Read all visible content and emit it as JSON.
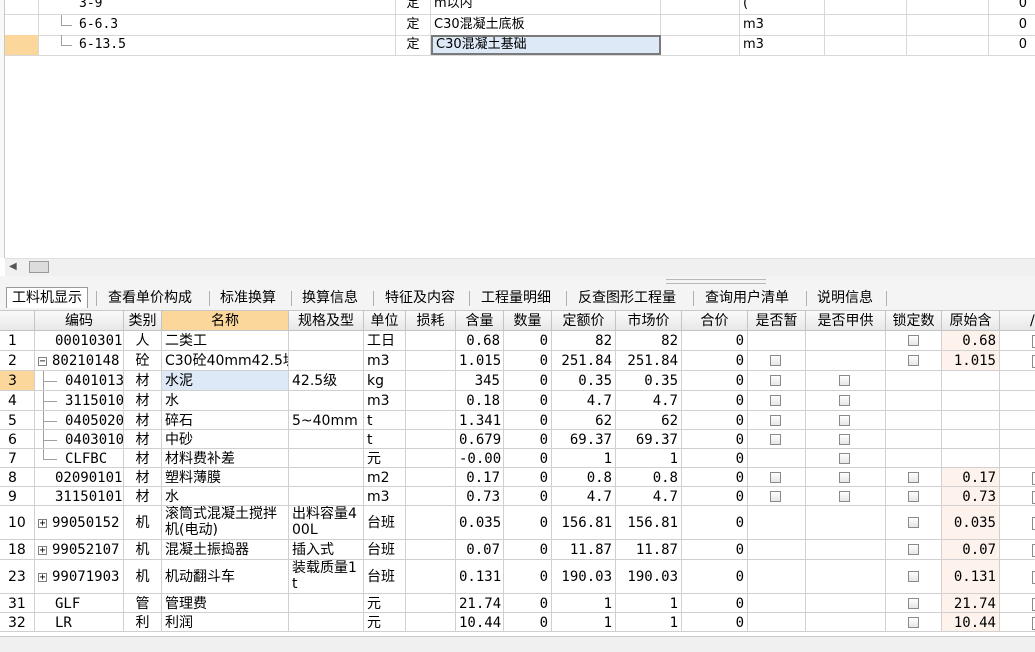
{
  "top_table": {
    "rows": [
      {
        "code": "3-9",
        "type": "定",
        "name": "m以内",
        "unit": "",
        "extra": "(",
        "last": "0"
      },
      {
        "code": "6-6.3",
        "type": "定",
        "name": "C30混凝土底板",
        "unit": "m3",
        "extra": "",
        "last": "0"
      },
      {
        "code": "6-13.5",
        "type": "定",
        "name": "C30混凝土基础",
        "unit": "m3",
        "extra": "",
        "last": "0"
      }
    ]
  },
  "tabs": [
    "工料机显示",
    "查看单价构成",
    "标准换算",
    "换算信息",
    "特征及内容",
    "工程量明细",
    "反查图形工程量",
    "查询用户清单",
    "说明信息"
  ],
  "grid": {
    "headers": [
      "编码",
      "类别",
      "名称",
      "规格及型",
      "单位",
      "损耗",
      "含量",
      "数量",
      "定额价",
      "市场价",
      "合价",
      "是否暂",
      "是否甲供",
      "锁定数",
      "原始含"
    ],
    "rows": [
      {
        "n": "1",
        "code": "00010301",
        "cat": "人",
        "name": "二类工",
        "spec": "",
        "unit": "工日",
        "loss": "",
        "qty": "0.68",
        "num": "0",
        "price": "82",
        "mkt": "82",
        "total": "0",
        "zan": false,
        "jia": false,
        "lock": true,
        "orig": "0.68"
      },
      {
        "n": "2",
        "code": "80210148",
        "cat": "砼",
        "name": "C30砼40mm42.5坍",
        "spec": "",
        "unit": "m3",
        "loss": "",
        "qty": "1.015",
        "num": "0",
        "price": "251.84",
        "mkt": "251.84",
        "total": "0",
        "zan": true,
        "jia": false,
        "lock": true,
        "orig": "1.015"
      },
      {
        "n": "3",
        "code": "0401013",
        "cat": "材",
        "name": "水泥",
        "spec": "42.5级",
        "unit": "kg",
        "loss": "",
        "qty": "345",
        "num": "0",
        "price": "0.35",
        "mkt": "0.35",
        "total": "0",
        "zan": true,
        "jia": true,
        "lock": false,
        "orig": ""
      },
      {
        "n": "4",
        "code": "3115010",
        "cat": "材",
        "name": "水",
        "spec": "",
        "unit": "m3",
        "loss": "",
        "qty": "0.18",
        "num": "0",
        "price": "4.7",
        "mkt": "4.7",
        "total": "0",
        "zan": true,
        "jia": true,
        "lock": false,
        "orig": ""
      },
      {
        "n": "5",
        "code": "0405020",
        "cat": "材",
        "name": "碎石",
        "spec": "5~40mm",
        "unit": "t",
        "loss": "",
        "qty": "1.341",
        "num": "0",
        "price": "62",
        "mkt": "62",
        "total": "0",
        "zan": true,
        "jia": true,
        "lock": false,
        "orig": ""
      },
      {
        "n": "6",
        "code": "0403010",
        "cat": "材",
        "name": "中砂",
        "spec": "",
        "unit": "t",
        "loss": "",
        "qty": "0.679",
        "num": "0",
        "price": "69.37",
        "mkt": "69.37",
        "total": "0",
        "zan": true,
        "jia": true,
        "lock": false,
        "orig": ""
      },
      {
        "n": "7",
        "code": "CLFBC",
        "cat": "材",
        "name": "材料费补差",
        "spec": "",
        "unit": "元",
        "loss": "",
        "qty": "-0.00",
        "num": "0",
        "price": "1",
        "mkt": "1",
        "total": "0",
        "zan": false,
        "jia": true,
        "lock": false,
        "orig": ""
      },
      {
        "n": "8",
        "code": "02090101",
        "cat": "材",
        "name": "塑料薄膜",
        "spec": "",
        "unit": "m2",
        "loss": "",
        "qty": "0.17",
        "num": "0",
        "price": "0.8",
        "mkt": "0.8",
        "total": "0",
        "zan": true,
        "jia": true,
        "lock": true,
        "orig": "0.17"
      },
      {
        "n": "9",
        "code": "31150101",
        "cat": "材",
        "name": "水",
        "spec": "",
        "unit": "m3",
        "loss": "",
        "qty": "0.73",
        "num": "0",
        "price": "4.7",
        "mkt": "4.7",
        "total": "0",
        "zan": true,
        "jia": true,
        "lock": true,
        "orig": "0.73"
      },
      {
        "n": "10",
        "code": "99050152",
        "cat": "机",
        "name": "滚筒式混凝土搅拌机(电动)",
        "name1": "滚筒式混凝土搅拌",
        "name2": "机(电动)",
        "spec": "出料容量400L",
        "spec1": "出料容量4",
        "spec2": "00L",
        "unit": "台班",
        "loss": "",
        "qty": "0.035",
        "num": "0",
        "price": "156.81",
        "mkt": "156.81",
        "total": "0",
        "zan": false,
        "jia": false,
        "lock": true,
        "orig": "0.035"
      },
      {
        "n": "18",
        "code": "99052107",
        "cat": "机",
        "name": "混凝土振捣器",
        "spec": "插入式",
        "unit": "台班",
        "loss": "",
        "qty": "0.07",
        "num": "0",
        "price": "11.87",
        "mkt": "11.87",
        "total": "0",
        "zan": false,
        "jia": false,
        "lock": true,
        "orig": "0.07"
      },
      {
        "n": "23",
        "code": "99071903",
        "cat": "机",
        "name": "机动翻斗车",
        "spec": "装载质量1t",
        "spec1": "装载质量1",
        "spec2": "t",
        "unit": "台班",
        "loss": "",
        "qty": "0.131",
        "num": "0",
        "price": "190.03",
        "mkt": "190.03",
        "total": "0",
        "zan": false,
        "jia": false,
        "lock": true,
        "orig": "0.131"
      },
      {
        "n": "31",
        "code": "GLF",
        "cat": "管",
        "name": "管理费",
        "spec": "",
        "unit": "元",
        "loss": "",
        "qty": "21.74",
        "num": "0",
        "price": "1",
        "mkt": "1",
        "total": "0",
        "zan": false,
        "jia": false,
        "lock": true,
        "orig": "21.74"
      },
      {
        "n": "32",
        "code": "LR",
        "cat": "利",
        "name": "利润",
        "spec": "",
        "unit": "元",
        "loss": "",
        "qty": "10.44",
        "num": "0",
        "price": "1",
        "mkt": "1",
        "total": "0",
        "zan": false,
        "jia": false,
        "lock": true,
        "orig": "10.44"
      }
    ]
  },
  "colors": {
    "selected_header": "#fbd79b",
    "selected_cell": "#dde9f7",
    "original_col": "#fdf3ec"
  }
}
